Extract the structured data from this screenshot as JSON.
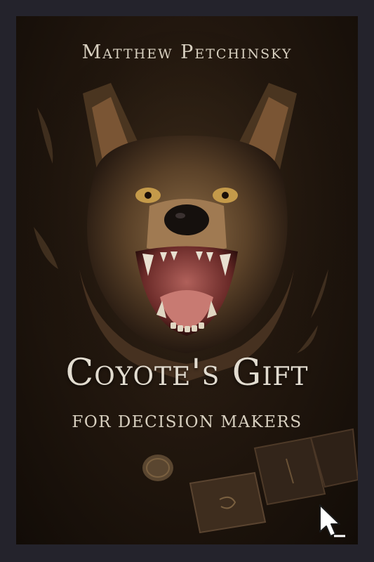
{
  "book": {
    "author": "Matthew Petchinsky",
    "title": "Coyote's Gift",
    "subtitle": "FOR DECISION MAKERS"
  },
  "colors": {
    "frame": "#24232c",
    "background": "#1a120b",
    "text": "#e2dcd0"
  },
  "icons": [
    "coyote-illustration",
    "coin-icon",
    "tarot-card-icon",
    "feather-icon",
    "look-inside-arrow-icon"
  ]
}
